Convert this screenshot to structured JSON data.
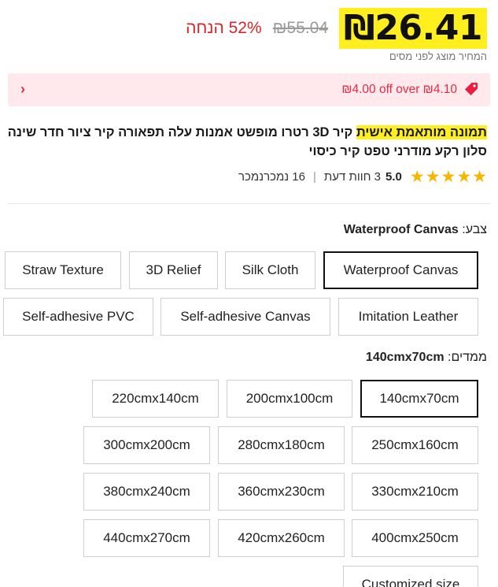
{
  "price": {
    "current": "₪26.41",
    "original": "₪55.04",
    "discount": "52% הנחה",
    "tax_note": "המחיר מוצג לפני מסים"
  },
  "coupon": {
    "icon": "tag-icon",
    "text": "₪4.00 off over ₪4.10",
    "chevron": "chevron-left-icon"
  },
  "product": {
    "title_highlight": "תמונה מותאמת אישית",
    "title_rest": " קיר 3D רטרו מופשט אמנות עלה תפאורה קיר ציור חדר שינה סלון רקע מודרני טפט קיר כיסוי"
  },
  "rating": {
    "stars": [
      "★",
      "★",
      "★",
      "★",
      "★"
    ],
    "value": "5.0",
    "reviews": "3 חוות דעת",
    "sold": "16 נמכרנמכר"
  },
  "color": {
    "label": "צבע: ",
    "selected": "Waterproof Canvas",
    "options": [
      "Waterproof Canvas",
      "Silk Cloth",
      "3D Relief",
      "Straw Texture",
      "Imitation Leather",
      "Self-adhesive Canvas",
      "Self-adhesive PVC"
    ]
  },
  "size": {
    "label": "ממדים: ",
    "selected": "140cmx70cm",
    "options": [
      "140cmx70cm",
      "200cmx100cm",
      "220cmx140cm",
      "250cmx160cm",
      "280cmx180cm",
      "300cmx200cm",
      "330cmx210cm",
      "360cmx230cm",
      "380cmx240cm",
      "400cmx250cm",
      "420cmx260cm",
      "440cmx270cm",
      "Customized size"
    ]
  },
  "colors": {
    "highlight": "#ffef1f",
    "discount_red": "#d8252b",
    "coupon_bg": "#ffe9ec",
    "star": "#f8b500"
  }
}
